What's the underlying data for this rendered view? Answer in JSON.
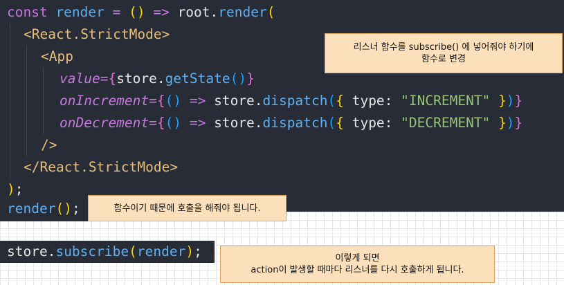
{
  "code": {
    "l1": {
      "const": "const",
      "name": " render ",
      "eq": "= ",
      "params": "()",
      "arrow": " => ",
      "root": "root.",
      "method": "render",
      "open": "("
    },
    "l2": {
      "open": "<",
      "tag": "React.StrictMode",
      "close": ">"
    },
    "l3": {
      "open": "<",
      "tag": "App"
    },
    "l4": {
      "attr": "value",
      "eq": "=",
      "ob": "{",
      "obj": "store.",
      "method": "getState",
      "parens": "()",
      "cb": "}"
    },
    "l5": {
      "attr": "onIncrement",
      "eq": "=",
      "ob": "{",
      "params": "()",
      "arrow": " => ",
      "obj": "store.",
      "method": "dispatch",
      "op": "(",
      "ob2": "{",
      "key": " type: ",
      "str": "\"INCREMENT\"",
      "cb2": " }",
      "cp": ")",
      "cb": "}"
    },
    "l6": {
      "attr": "onDecrement",
      "eq": "=",
      "ob": "{",
      "params": "()",
      "arrow": " => ",
      "obj": "store.",
      "method": "dispatch",
      "op": "(",
      "ob2": "{",
      "key": " type: ",
      "str": "\"DECREMENT\"",
      "cb2": " }",
      "cp": ")",
      "cb": "}"
    },
    "l7": {
      "selfclose": "/>"
    },
    "l8": {
      "open": "</",
      "tag": "React.StrictMode",
      "close": ">"
    },
    "l9": {
      "close": ")",
      "semi": ";"
    },
    "l10": {
      "method": "render",
      "parens": "()",
      "semi": ";"
    },
    "l12": {
      "obj": "store.",
      "method": "subscribe",
      "op": "(",
      "arg": "render",
      "cp": ")",
      "semi": ";"
    }
  },
  "notes": {
    "subscribe_hint": {
      "line1": "리스너 함수를 subscribe() 에 넣어줘야 하기에",
      "line2": "함수로 변경"
    },
    "call_hint": {
      "line1": "함수이기 때문에 호출을 해줘야 됩니다."
    },
    "action_hint": {
      "line1": "이렇게 되면",
      "line2": "action이 발생할 때마다 리스너를 다시 호출하게 됩니다."
    }
  },
  "colors": {
    "code_bg": "#272c36",
    "keyword": "#c678dd",
    "function": "#61afef",
    "tag": "#e5c07b",
    "string": "#98c379",
    "note_bg": "#fbe0bb",
    "note_border": "#e0a35a"
  }
}
